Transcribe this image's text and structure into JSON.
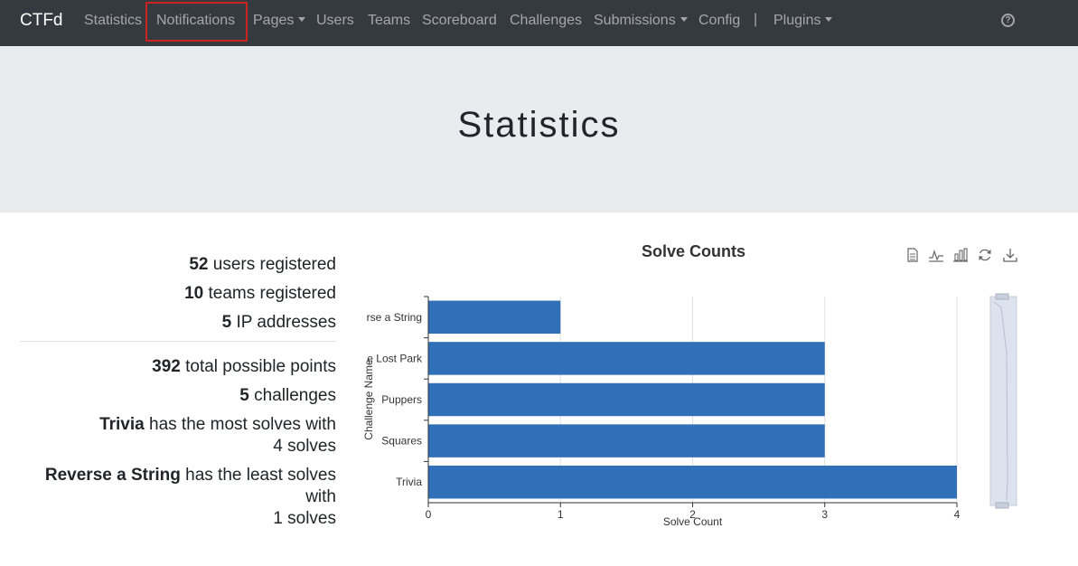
{
  "navbar": {
    "brand": "CTFd",
    "items": [
      {
        "label": "Statistics",
        "dropdown": false
      },
      {
        "label": "Notifications",
        "dropdown": false
      },
      {
        "label": "Pages",
        "dropdown": true
      },
      {
        "label": "Users",
        "dropdown": false
      },
      {
        "label": "Teams",
        "dropdown": false
      },
      {
        "label": "Scoreboard",
        "dropdown": false
      },
      {
        "label": "Challenges",
        "dropdown": false
      },
      {
        "label": "Submissions",
        "dropdown": true
      },
      {
        "label": "Config",
        "dropdown": false
      },
      {
        "label": "Plugins",
        "dropdown": true
      }
    ],
    "separator": "|",
    "help_icon": "question-circle-icon"
  },
  "annotation": {
    "highlight_color": "#cc2222"
  },
  "page": {
    "title": "Statistics"
  },
  "stats": {
    "users": {
      "count": "52",
      "text": "users registered"
    },
    "teams": {
      "count": "10",
      "text": "teams registered"
    },
    "ips": {
      "count": "5",
      "text": "IP addresses"
    },
    "points": {
      "count": "392",
      "text": "total possible points"
    },
    "challenges": {
      "count": "5",
      "text": "challenges"
    },
    "most": {
      "name": "Trivia",
      "text": "has the most solves with",
      "solves": "4 solves"
    },
    "least": {
      "name": "Reverse a String",
      "text": "has the least solves",
      "with": "with",
      "solves": "1 solves"
    }
  },
  "chart_data": {
    "type": "bar",
    "orientation": "horizontal",
    "title": "Solve Counts",
    "xlabel": "Solve Count",
    "ylabel": "Challenge Name",
    "categories": [
      "rse a String",
      "e Lost Park",
      "Puppers",
      "Squares",
      "Trivia"
    ],
    "values": [
      1,
      3,
      3,
      3,
      4
    ],
    "xlim": [
      0,
      4
    ],
    "xticks": [
      "0",
      "1",
      "2",
      "3",
      "4"
    ],
    "grid": true,
    "bar_color": "#3070b8",
    "toolbar": [
      "data-view-icon",
      "line-chart-icon",
      "bar-chart-icon",
      "refresh-icon",
      "download-icon"
    ]
  },
  "colors": {
    "navbar_bg": "#343a40",
    "jumbotron_bg": "#e9ecef",
    "bar": "#3070b8"
  }
}
